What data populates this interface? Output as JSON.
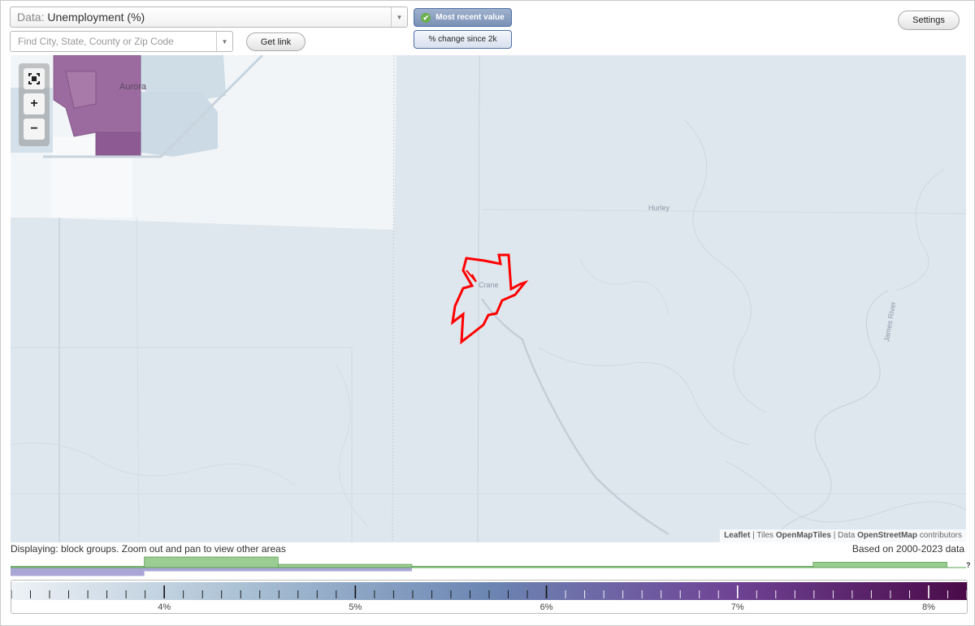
{
  "controls": {
    "data_prefix": "Data:",
    "data_value": "Unemployment (%)",
    "search_placeholder": "Find City, State, County or Zip Code",
    "get_link_label": "Get link",
    "most_recent_label": "Most recent value",
    "change_label": "% change since 2k",
    "settings_label": "Settings"
  },
  "map": {
    "labels": {
      "aurora": "Aurora",
      "hurley": "Hurley",
      "crane": "Crane",
      "river": "James River"
    },
    "colors": {
      "water": "#dfe7ee",
      "highlight": "#ff0000",
      "high_value": "#9b6a9e"
    },
    "attribution": {
      "leaflet": "Leaflet",
      "tiles_prefix": "Tiles",
      "tiles": "OpenMapTiles",
      "data_prefix": "Data",
      "data": "OpenStreetMap",
      "suffix": "contributors"
    }
  },
  "footer": {
    "status": "Displaying: block groups. Zoom out and pan to view other areas",
    "range": "Based on 2000-2023 data",
    "legend_question": "?"
  },
  "chart_data": {
    "type": "heatmap",
    "title": "",
    "xlabel": "",
    "ylabel": "",
    "xlim": [
      3.2,
      8.2
    ],
    "x_ticks": [
      4,
      5,
      6,
      7,
      8
    ],
    "tick_labels": [
      "4%",
      "5%",
      "6%",
      "7%",
      "8%"
    ],
    "color_stops": [
      "#eef2f6",
      "#a8bfd3",
      "#6c86b3",
      "#6f4496",
      "#4a0a48"
    ],
    "histogram": [
      {
        "from": 3.2,
        "to": 3.9,
        "level": 0.1
      },
      {
        "from": 3.9,
        "to": 4.6,
        "level": 1.0
      },
      {
        "from": 4.6,
        "to": 5.3,
        "level": 0.3
      },
      {
        "from": 5.3,
        "to": 7.4,
        "level": 0.1
      },
      {
        "from": 7.4,
        "to": 8.1,
        "level": 0.5
      }
    ],
    "selected_bins": [
      {
        "from": 3.2,
        "to": 3.9,
        "level": 0.8
      },
      {
        "from": 3.9,
        "to": 5.3,
        "level": 0.35
      }
    ]
  }
}
